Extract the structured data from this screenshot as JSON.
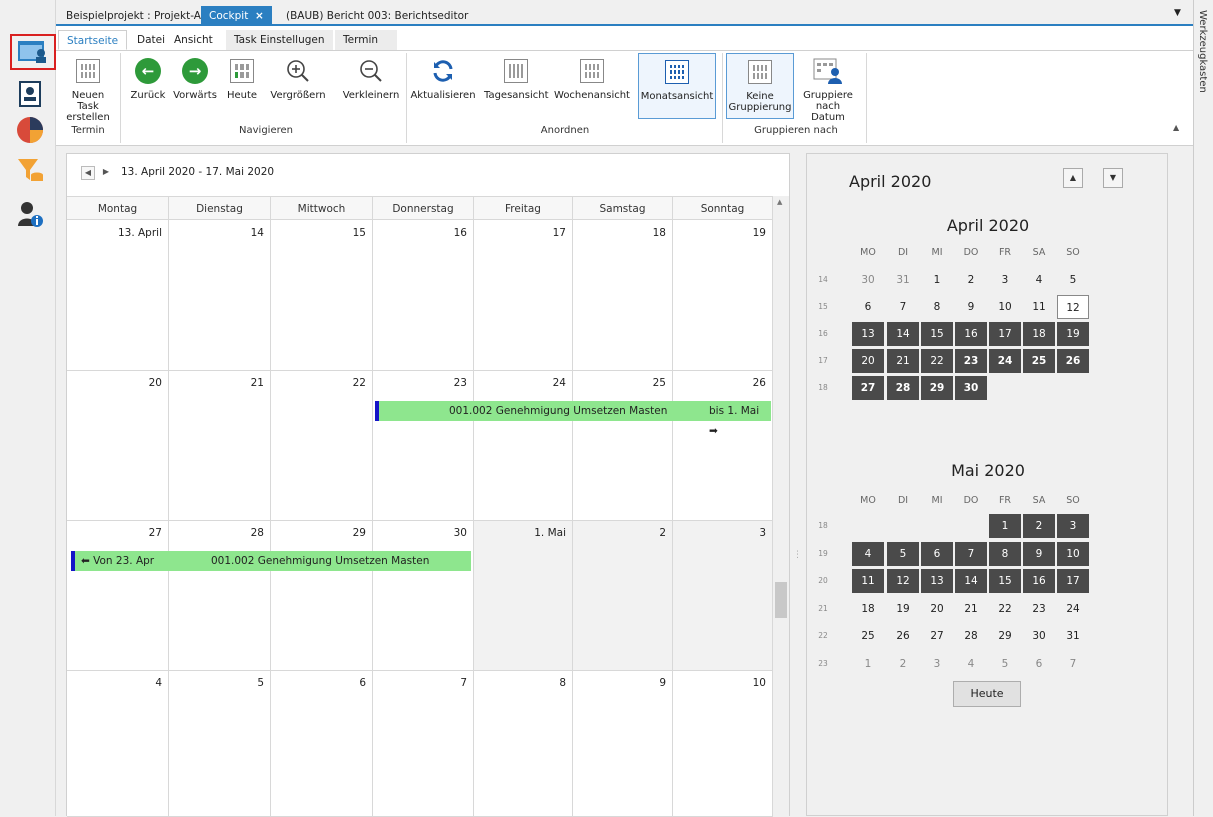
{
  "doc_tabs": [
    {
      "label": "Beispielprojekt : Projekt-Adressbuch"
    },
    {
      "label": "Cockpit",
      "close": "×"
    },
    {
      "label": "(BAUB) Bericht 003: Berichtseditor"
    }
  ],
  "tab_dropdown": "▼",
  "right_panel_label": "Werkzeugkasten",
  "ribbon_tabs": [
    "Startseite",
    "Datei",
    "Ansicht",
    "Task Einstellugen",
    "Termin"
  ],
  "ribbon": {
    "new_task": "Neuen Task erstellen",
    "back": "Zurück",
    "forward": "Vorwärts",
    "today": "Heute",
    "zoom_in": "Vergrößern",
    "zoom_out": "Verkleinern",
    "refresh": "Aktualisieren",
    "day_view": "Tagesansicht",
    "week_view": "Wochenansicht",
    "month_view": "Monatsansicht",
    "no_group": "Keine Gruppierung",
    "group_date": "Gruppiere nach Datum",
    "groups": {
      "termin": "Termin",
      "navigieren": "Navigieren",
      "anordnen": "Anordnen",
      "gruppieren": "Gruppieren nach"
    },
    "collapse": "▲"
  },
  "calendar": {
    "range": "13. April 2020 - 17. Mai 2020",
    "weekdays": [
      "Montag",
      "Dienstag",
      "Mittwoch",
      "Donnerstag",
      "Freitag",
      "Samstag",
      "Sonntag"
    ],
    "weeks": [
      [
        "13. April",
        "14",
        "15",
        "16",
        "17",
        "18",
        "19"
      ],
      [
        "20",
        "21",
        "22",
        "23",
        "24",
        "25",
        "26"
      ],
      [
        "27",
        "28",
        "29",
        "30",
        "1. Mai",
        "2",
        "3"
      ],
      [
        "4",
        "5",
        "6",
        "7",
        "8",
        "9",
        "10"
      ]
    ],
    "appt1": {
      "title": "001.002 Genehmigung Umsetzen Masten",
      "end": "bis 1. Mai ➡"
    },
    "appt2": {
      "title": "001.002 Genehmigung Umsetzen Masten",
      "start": "⬅ Von 23. Apr"
    }
  },
  "navigator": {
    "title": "April 2020",
    "april": {
      "title": "April 2020",
      "dow": [
        "MO",
        "DI",
        "MI",
        "DO",
        "FR",
        "SA",
        "SO"
      ],
      "weeks": [
        "14",
        "15",
        "16",
        "17",
        "18"
      ],
      "rows": [
        [
          "30",
          "31",
          "1",
          "2",
          "3",
          "4",
          "5"
        ],
        [
          "6",
          "7",
          "8",
          "9",
          "10",
          "11",
          "12"
        ],
        [
          "13",
          "14",
          "15",
          "16",
          "17",
          "18",
          "19"
        ],
        [
          "20",
          "21",
          "22",
          "23",
          "24",
          "25",
          "26"
        ],
        [
          "27",
          "28",
          "29",
          "30",
          "",
          "",
          ""
        ]
      ]
    },
    "mai": {
      "title": "Mai 2020",
      "dow": [
        "MO",
        "DI",
        "MI",
        "DO",
        "FR",
        "SA",
        "SO"
      ],
      "weeks": [
        "18",
        "19",
        "20",
        "21",
        "22",
        "23"
      ],
      "rows": [
        [
          "",
          "",
          "",
          "",
          "1",
          "2",
          "3"
        ],
        [
          "4",
          "5",
          "6",
          "7",
          "8",
          "9",
          "10"
        ],
        [
          "11",
          "12",
          "13",
          "14",
          "15",
          "16",
          "17"
        ],
        [
          "18",
          "19",
          "20",
          "21",
          "22",
          "23",
          "24"
        ],
        [
          "25",
          "26",
          "27",
          "28",
          "29",
          "30",
          "31"
        ],
        [
          "1",
          "2",
          "3",
          "4",
          "5",
          "6",
          "7"
        ]
      ]
    },
    "today_button": "Heute",
    "spin_up": "▲",
    "spin_down": "▼"
  }
}
